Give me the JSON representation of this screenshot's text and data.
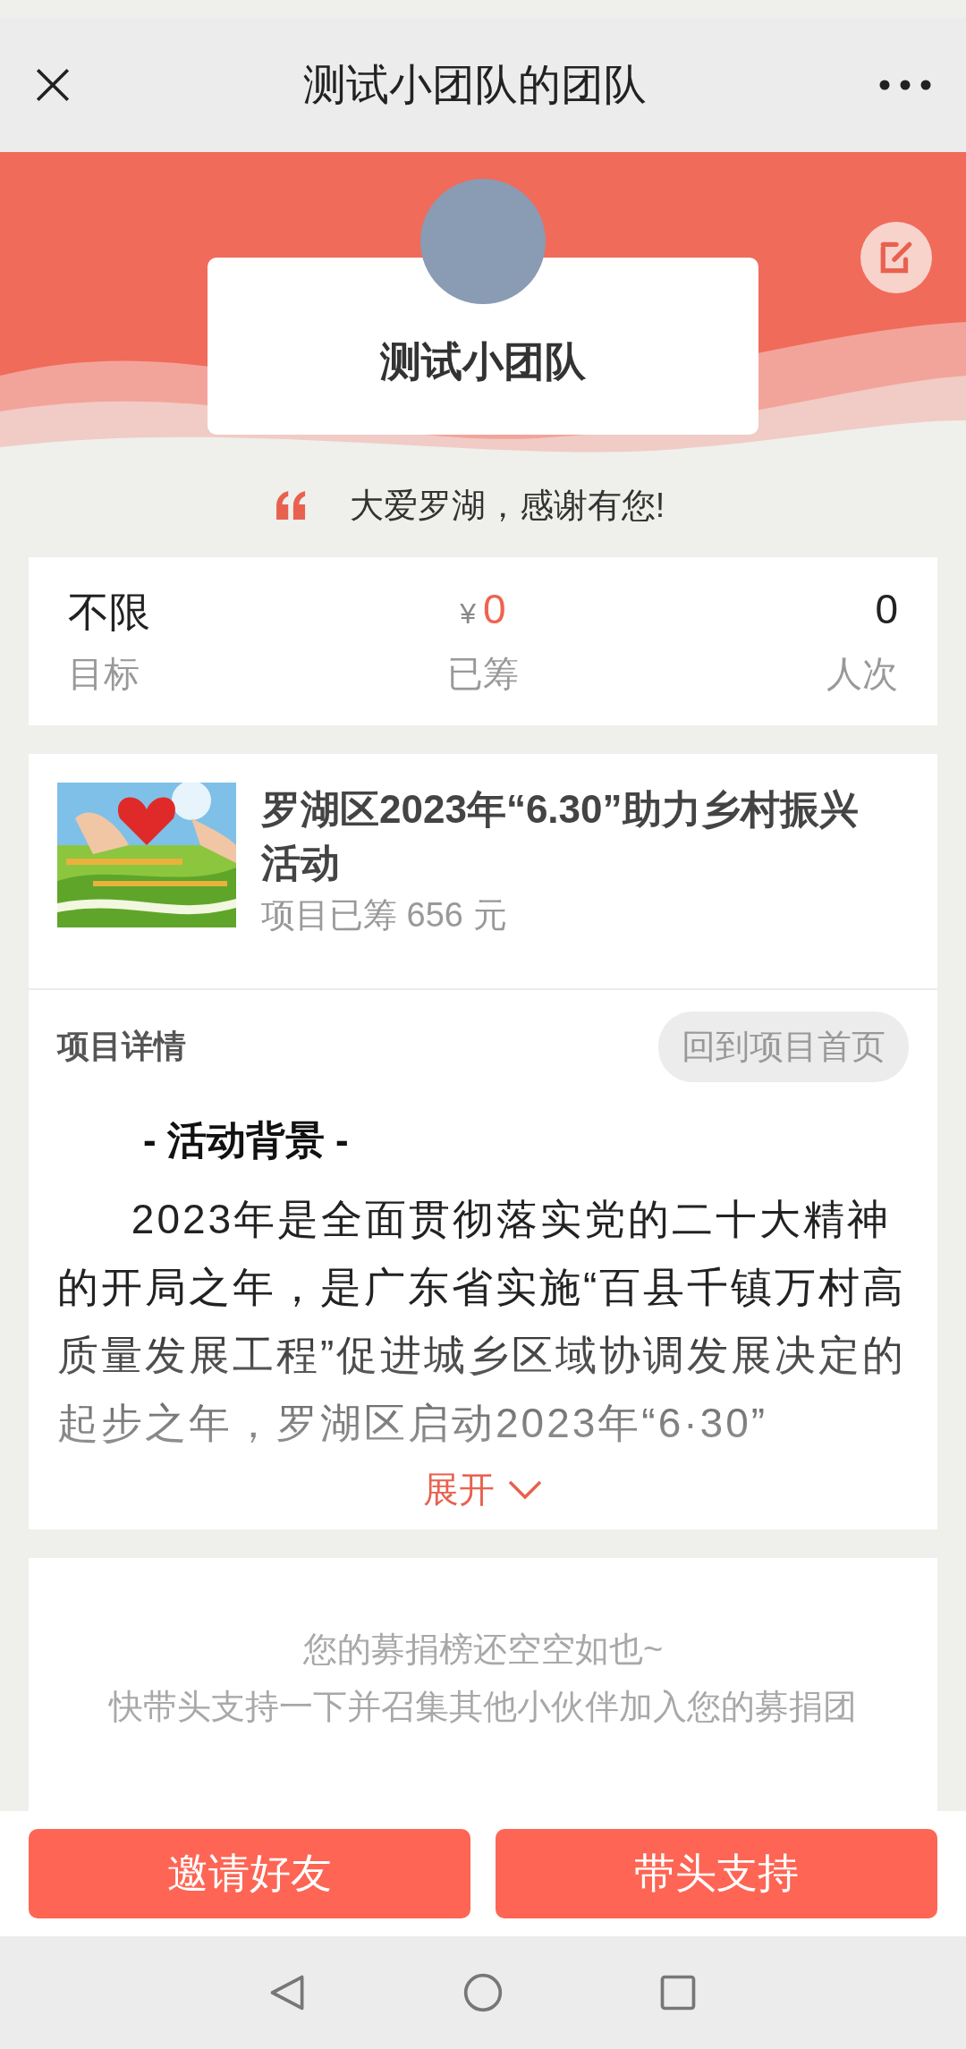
{
  "header": {
    "title": "测试小团队的团队"
  },
  "team": {
    "name": "测试小团队",
    "motto": "大爱罗湖，感谢有您!"
  },
  "stats": [
    {
      "kind": "plain",
      "value": "不限",
      "label": "目标"
    },
    {
      "kind": "money",
      "currency": "¥",
      "value": "0",
      "label": "已筹"
    },
    {
      "kind": "plain",
      "value": "0",
      "label": "人次"
    }
  ],
  "project": {
    "title": "罗湖区2023年“6.30”助力乡村振兴活动",
    "raised": "项目已筹 656 元"
  },
  "details": {
    "heading": "项目详情",
    "home_button": "回到项目首页",
    "section_title": "- 活动背景 -",
    "paragraph": "2023年是全面贯彻落实党的二十大精神的开局之年，是广东省实施“百县千镇万村高质量发展工程”促进城乡区域协调发展决定的起步之年，罗湖区启动2023年“6·30”",
    "expand": "展开",
    "expanded": false
  },
  "leaderboard": {
    "empty_lines": [
      "您的募捐榜还空空如也~",
      "快带头支持一下并召集其他小伙伴加入您的募捐团"
    ]
  },
  "actions": [
    "邀请好友",
    "带头支持"
  ]
}
